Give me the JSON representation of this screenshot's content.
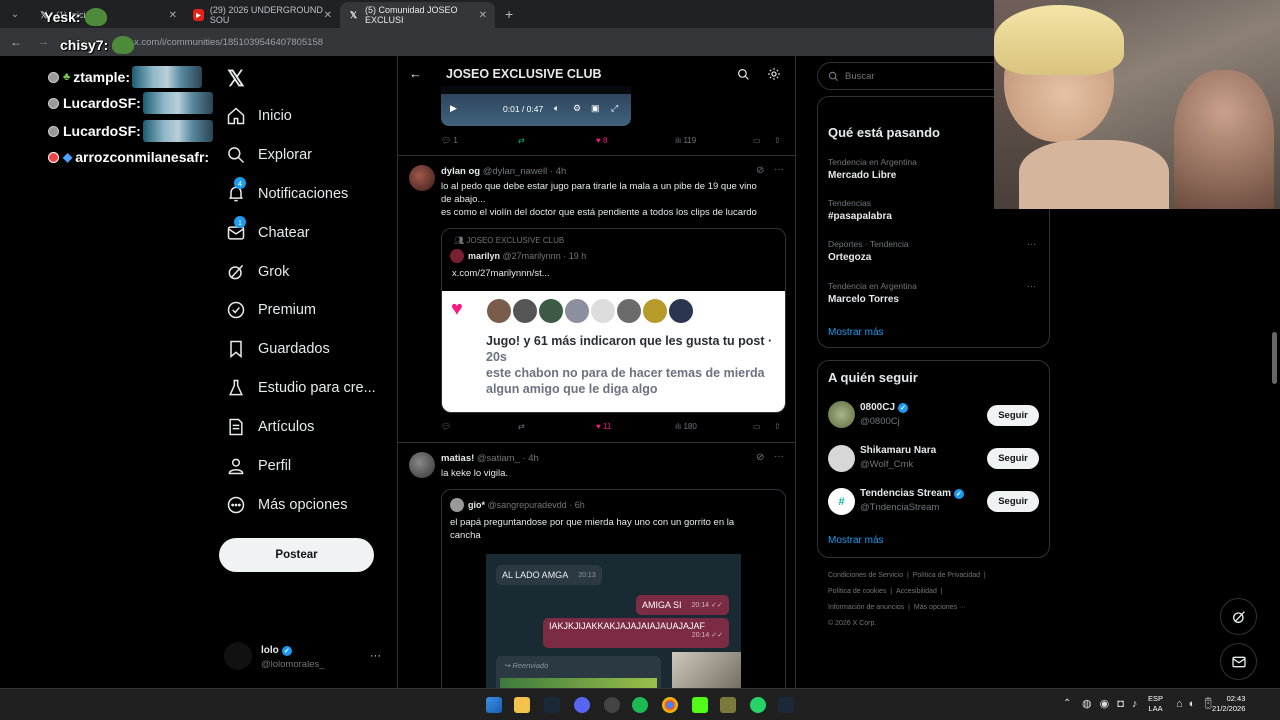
{
  "browser": {
    "tabs": [
      {
        "label": "(1) Inicio / X",
        "icon": "x-logo-icon"
      },
      {
        "label": "(29) 2026 UNDERGROUND SOU",
        "icon": "youtube-icon"
      },
      {
        "label": "(5) Comunidad JOSEO EXCLUSI",
        "icon": "x-logo-icon"
      }
    ],
    "new_tab": "+",
    "url": "x.com/i/communities/1851039546407805158"
  },
  "overlay": {
    "users": [
      "Yesk:",
      "chisy7:",
      "ztample:",
      "LucardoSF:",
      "LucardoSF:",
      "arrozconmilanesafr:"
    ]
  },
  "nav": {
    "items": [
      "Inicio",
      "Explorar",
      "Notificaciones",
      "Chatear",
      "Grok",
      "Premium",
      "Guardados",
      "Estudio para cre...",
      "Artículos",
      "Perfil",
      "Más opciones"
    ],
    "badges": {
      "notif": "4",
      "chat": "1"
    },
    "post_button": "Postear",
    "account": {
      "name": "lolo",
      "handle": "@lolomorales_",
      "more": "···"
    }
  },
  "header": {
    "title": "JOSEO EXCLUSIVE CLUB"
  },
  "video": {
    "time": "0:01 / 0:47"
  },
  "post0": {
    "replies": "1",
    "likes": "8",
    "views": "119"
  },
  "post1": {
    "name": "dylan og",
    "handle": "@dylan_nawell",
    "time": "· 4h",
    "text1": "lo al pedo que debe estar jugo para tirarle la mala a un pibe de 19 que vino",
    "text2": "de abajo...",
    "text3": "es como el violín del doctor que está pendiente a todos los clips de lucardo",
    "quote": {
      "community": "JOSEO EXCLUSIVE CLUB",
      "name": "marilyn",
      "handle": "@27marilynnn · 19 h",
      "link": "x.com/27marilynnn/st...",
      "img_line1": "Jugo! y 61 más indicaron que les gusta tu post ·",
      "img_line2": "20s",
      "img_line3": "este chabon no para de hacer temas de mierda",
      "img_line4": "algun amigo que le diga algo"
    },
    "likes": "11",
    "views": "180"
  },
  "post2": {
    "name": "matias!",
    "handle": "@satiam_",
    "time": "· 4h",
    "text": "la keke lo vigila.",
    "quote": {
      "name": "gio*",
      "handle": "@sangrepuradevdd · 6h",
      "text1": "el papá preguntandose por que mierda hay uno con un gorrito en la",
      "text2": "cancha",
      "chat1": "AL LADO AMGA",
      "chat1_time": "20:13",
      "chat2": "AMIGA SI",
      "chat2_time": "20:14 ✓✓",
      "chat3": "IAKJKJIJAKKAKJAJAJAIAJAUAJAJAF",
      "chat3_time": "20:14 ✓✓",
      "forwarded": "Reenviado"
    }
  },
  "search": {
    "placeholder": "Buscar"
  },
  "trends": {
    "title": "Qué está pasando",
    "items": [
      {
        "context": "Tendencia en Argentina",
        "name": "Mercado Libre"
      },
      {
        "context": "Tendencias",
        "name": "#pasapalabra"
      },
      {
        "context": "Deportes · Tendencia",
        "name": "Ortegoza"
      },
      {
        "context": "Tendencia en Argentina",
        "name": "Marcelo Torres"
      }
    ],
    "more": "Mostrar más"
  },
  "follow": {
    "title": "A quién seguir",
    "items": [
      {
        "name": "0800CJ",
        "handle": "@0800Cj",
        "button": "Seguir"
      },
      {
        "name": "Shikamaru Nara",
        "handle": "@Wolf_Cmk",
        "button": "Seguir"
      },
      {
        "name": "Tendencias Stream",
        "handle": "@TndenciaStream",
        "button": "Seguir"
      }
    ],
    "more": "Mostrar más"
  },
  "footer": {
    "l1a": "Condiciones de Servicio",
    "l1b": "Política de Privacidad",
    "l2a": "Política de cookies",
    "l2b": "Accesibilidad",
    "l3a": "Información de anuncios",
    "l3b": "Más opciones ···",
    "copy": "© 2026 X Corp."
  },
  "taskbar": {
    "lang1": "ESP",
    "lang2": "LAA",
    "time": "02:43",
    "date": "21/2/2026"
  }
}
